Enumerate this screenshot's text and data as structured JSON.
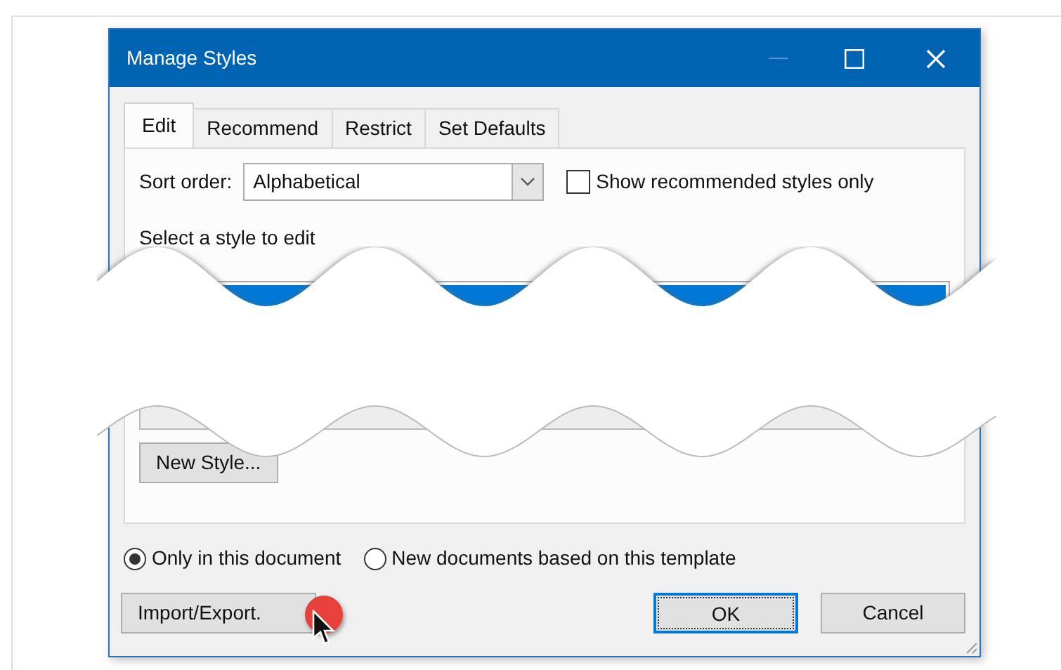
{
  "window": {
    "title": "Manage Styles"
  },
  "tabs": [
    {
      "label": "Edit",
      "selected": true
    },
    {
      "label": "Recommend",
      "selected": false
    },
    {
      "label": "Restrict",
      "selected": false
    },
    {
      "label": "Set Defaults",
      "selected": false
    }
  ],
  "sort_order": {
    "label": "Sort order:",
    "value": "Alphabetical"
  },
  "show_recommended": {
    "label": "Show recommended styles only",
    "checked": false
  },
  "select_label": "Select a style to edit",
  "new_style_button": {
    "label": "New Style..."
  },
  "scope_options": [
    {
      "label": "Only in this document",
      "selected": true
    },
    {
      "label": "New documents based on this template",
      "selected": false
    }
  ],
  "buttons": [
    {
      "label": "Import/Export.",
      "focused": false,
      "kind": "left"
    },
    {
      "label": "OK",
      "focused": true,
      "kind": "right"
    },
    {
      "label": "Cancel",
      "focused": false,
      "kind": "right"
    }
  ]
}
